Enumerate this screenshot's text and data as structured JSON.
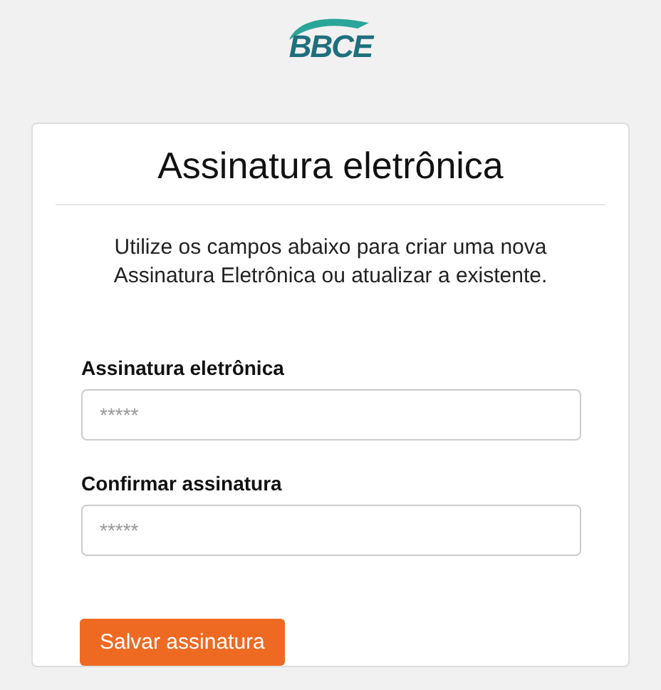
{
  "logo": {
    "text": "BBCE"
  },
  "card": {
    "title": "Assinatura eletrônica",
    "description": "Utilize os campos abaixo para criar uma nova Assinatura Eletrônica ou atualizar a existente.",
    "fields": [
      {
        "label": "Assinatura eletrônica",
        "placeholder": "*****"
      },
      {
        "label": "Confirmar assinatura",
        "placeholder": "*****"
      }
    ],
    "button": "Salvar assinatura"
  }
}
